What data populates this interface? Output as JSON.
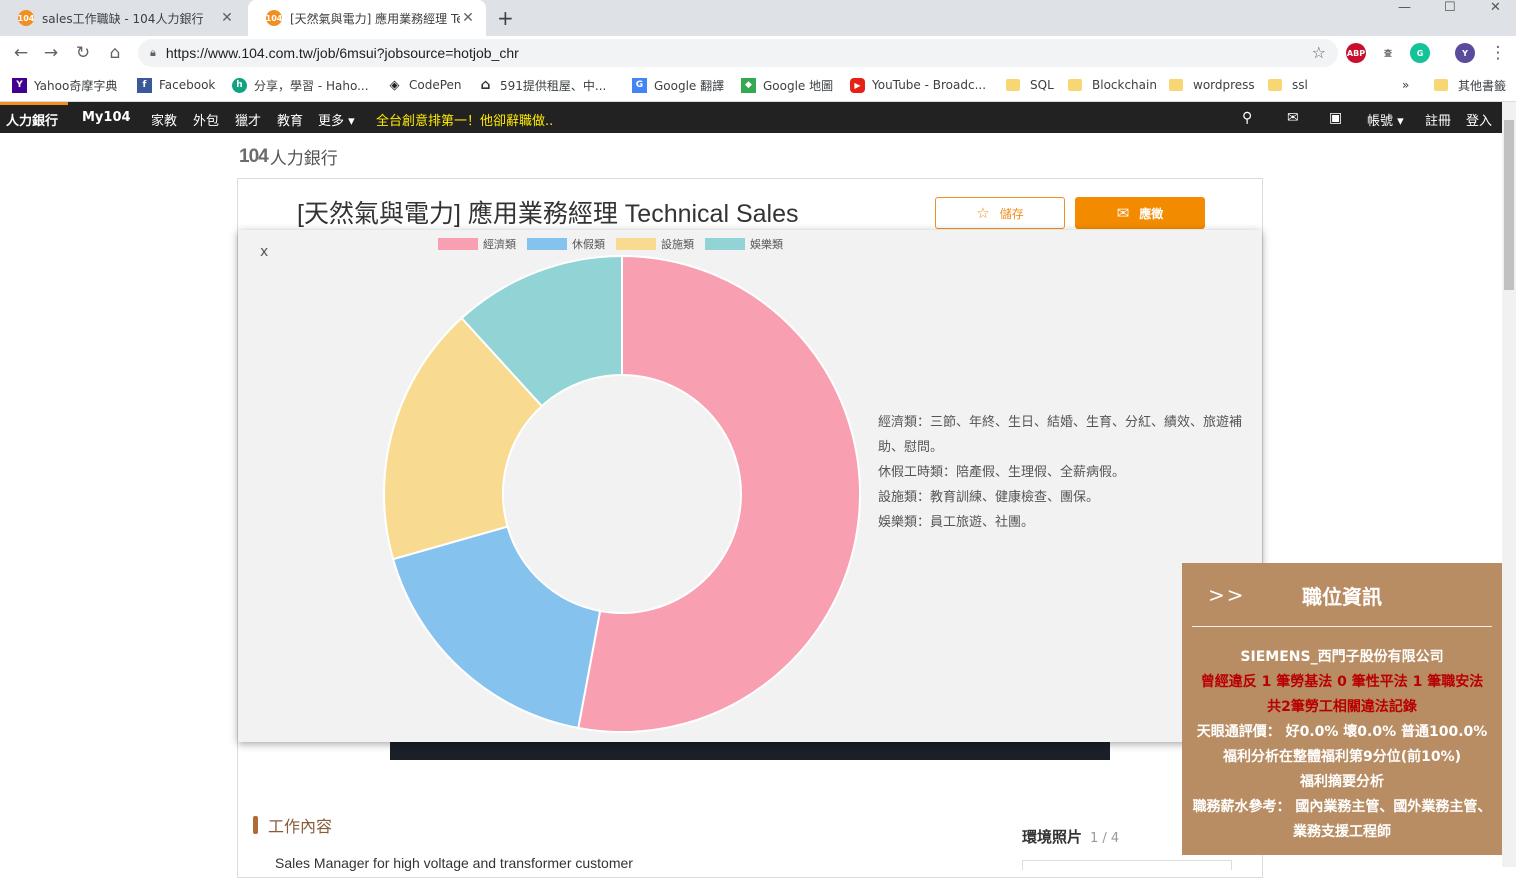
{
  "tabs": [
    {
      "title": "sales工作職缺 - 104人力銀行",
      "favicon": "104"
    },
    {
      "title": "[天然氣與電力] 應用業務經理 Tec",
      "favicon": "104"
    }
  ],
  "address_bar": {
    "url": "https://www.104.com.tw/job/6msui?jobsource=hotjob_chr"
  },
  "extensions": [
    "ABP",
    "G",
    "Y"
  ],
  "bookmarks": [
    {
      "label": "Yahoo奇摩字典",
      "icon": "yahoo-icon"
    },
    {
      "label": "Facebook",
      "icon": "facebook-icon"
    },
    {
      "label": "分享，學習 - Haho...",
      "icon": "hahow-icon"
    },
    {
      "label": "CodePen",
      "icon": "codepen-icon"
    },
    {
      "label": "591提供租屋、中...",
      "icon": "house-icon"
    },
    {
      "label": "Google 翻譯",
      "icon": "google-translate-icon"
    },
    {
      "label": "Google 地圖",
      "icon": "google-maps-icon"
    },
    {
      "label": "YouTube - Broadc...",
      "icon": "youtube-icon"
    },
    {
      "label": "SQL",
      "icon": "folder-icon"
    },
    {
      "label": "Blockchain",
      "icon": "folder-icon"
    },
    {
      "label": "wordpress",
      "icon": "folder-icon"
    },
    {
      "label": "ssl",
      "icon": "folder-icon"
    },
    {
      "label": "»",
      "icon": ""
    },
    {
      "label": "其他書籤",
      "icon": "folder-icon"
    }
  ],
  "site_nav": {
    "left": [
      "人力銀行",
      "My104",
      "家教",
      "外包",
      "獵才",
      "教育",
      "更多 ▾"
    ],
    "promo": "全台創意排第一！他卻辭職做..",
    "right": [
      "帳號 ▾",
      "註冊",
      "登入"
    ]
  },
  "logo": {
    "number": "104",
    "text": "人力銀行"
  },
  "job": {
    "title": "[天然氣與電力] 應用業務經理 Technical Sales",
    "save_label": "儲存",
    "apply_label": "應徵",
    "section_title": "工作內容",
    "description_snippet": "Sales Manager for high voltage and transformer customer",
    "env_photo_label": "環境照片",
    "env_photo_count": "1 / 4"
  },
  "modal": {
    "close_label": "x",
    "descriptions": [
      "經濟類：三節、年終、生日、結婚、生育、分紅、績效、旅遊補助、慰問。",
      "休假工時類：陪產假、生理假、全薪病假。",
      "設施類：教育訓練、健康檢查、團保。",
      "娛樂類：員工旅遊、社團。"
    ]
  },
  "chart_data": {
    "type": "pie",
    "variant": "doughnut",
    "categories": [
      "經濟類",
      "休假類",
      "設施類",
      "娛樂類"
    ],
    "values": [
      9,
      3,
      3,
      2
    ],
    "colors": [
      "#f89fb1",
      "#85c2ee",
      "#f9da91",
      "#92d4d6"
    ],
    "legend": "top"
  },
  "side_panel": {
    "arrow": ">>",
    "title": "職位資訊",
    "company": "SIEMENS_西門子股份有限公司",
    "violation_1": "曾經違反 1 筆勞基法 0 筆性平法 1 筆職安法",
    "violation_2": "共2筆勞工相關違法記錄",
    "rating": "天眼通評價： 好0.0% 壞0.0% 普通100.0%",
    "welfare_rank": "福利分析在整體福利第9分位(前10%)",
    "welfare_summary": "福利摘要分析",
    "salary_ref": "職務薪水參考： 國內業務主管、國外業務主管、業務支援工程師"
  }
}
